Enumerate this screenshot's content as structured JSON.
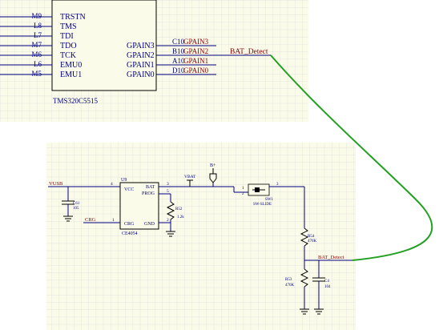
{
  "top_block": {
    "chip_name": "TMS320C5515",
    "left_pins": [
      {
        "num": "M9",
        "name": "TRSTN"
      },
      {
        "num": "L8",
        "name": "TMS"
      },
      {
        "num": "L7",
        "name": "TDI"
      },
      {
        "num": "M7",
        "name": "TDO"
      },
      {
        "num": "M6",
        "name": "TCK"
      },
      {
        "num": "L6",
        "name": "EMU0"
      },
      {
        "num": "M5",
        "name": "EMU1"
      }
    ],
    "right_pins": [
      {
        "num": "C10",
        "name": "GPAIN3",
        "net": "GPAIN3"
      },
      {
        "num": "B10",
        "name": "GPAIN2",
        "net": "GPAIN2"
      },
      {
        "num": "A10",
        "name": "GPAIN1",
        "net": "GPAIN1"
      },
      {
        "num": "D10",
        "name": "GPAIN0",
        "net": "GPAIN0"
      }
    ],
    "net_label": "BAT_Detect"
  },
  "bottom_block": {
    "vusb": "VUSB",
    "c61": {
      "ref": "C61",
      "val": "105"
    },
    "u9": {
      "ref": "U9",
      "part": "CE4054",
      "pins": {
        "vcc": "VCC",
        "bat": "BAT",
        "prog": "PROG",
        "crg": "CRG",
        "gnd": "GND"
      },
      "pin_nums": {
        "vcc": "4",
        "bat": "3",
        "prog": "5",
        "crg": "1",
        "gnd": "2"
      }
    },
    "crg": "CRG",
    "r52": {
      "ref": "R52",
      "val": "1.2k"
    },
    "vbat": "VBAT",
    "bplus": "B+",
    "sw1": {
      "ref": "SW1",
      "part": "SW-SLIDE",
      "pins": [
        "1",
        "2",
        "3"
      ]
    },
    "r54": {
      "ref": "R54",
      "val": "470K"
    },
    "r53": {
      "ref": "R53",
      "val": "470K"
    },
    "c4": {
      "ref": "C4",
      "val": "104"
    },
    "net_label": "BAT_Detect"
  },
  "colors": {
    "sheet_bg": "#fbfbea",
    "grid": "#dcdcdc",
    "wire": "#000080",
    "net_text": "#8b0000",
    "link": "#22a022"
  }
}
